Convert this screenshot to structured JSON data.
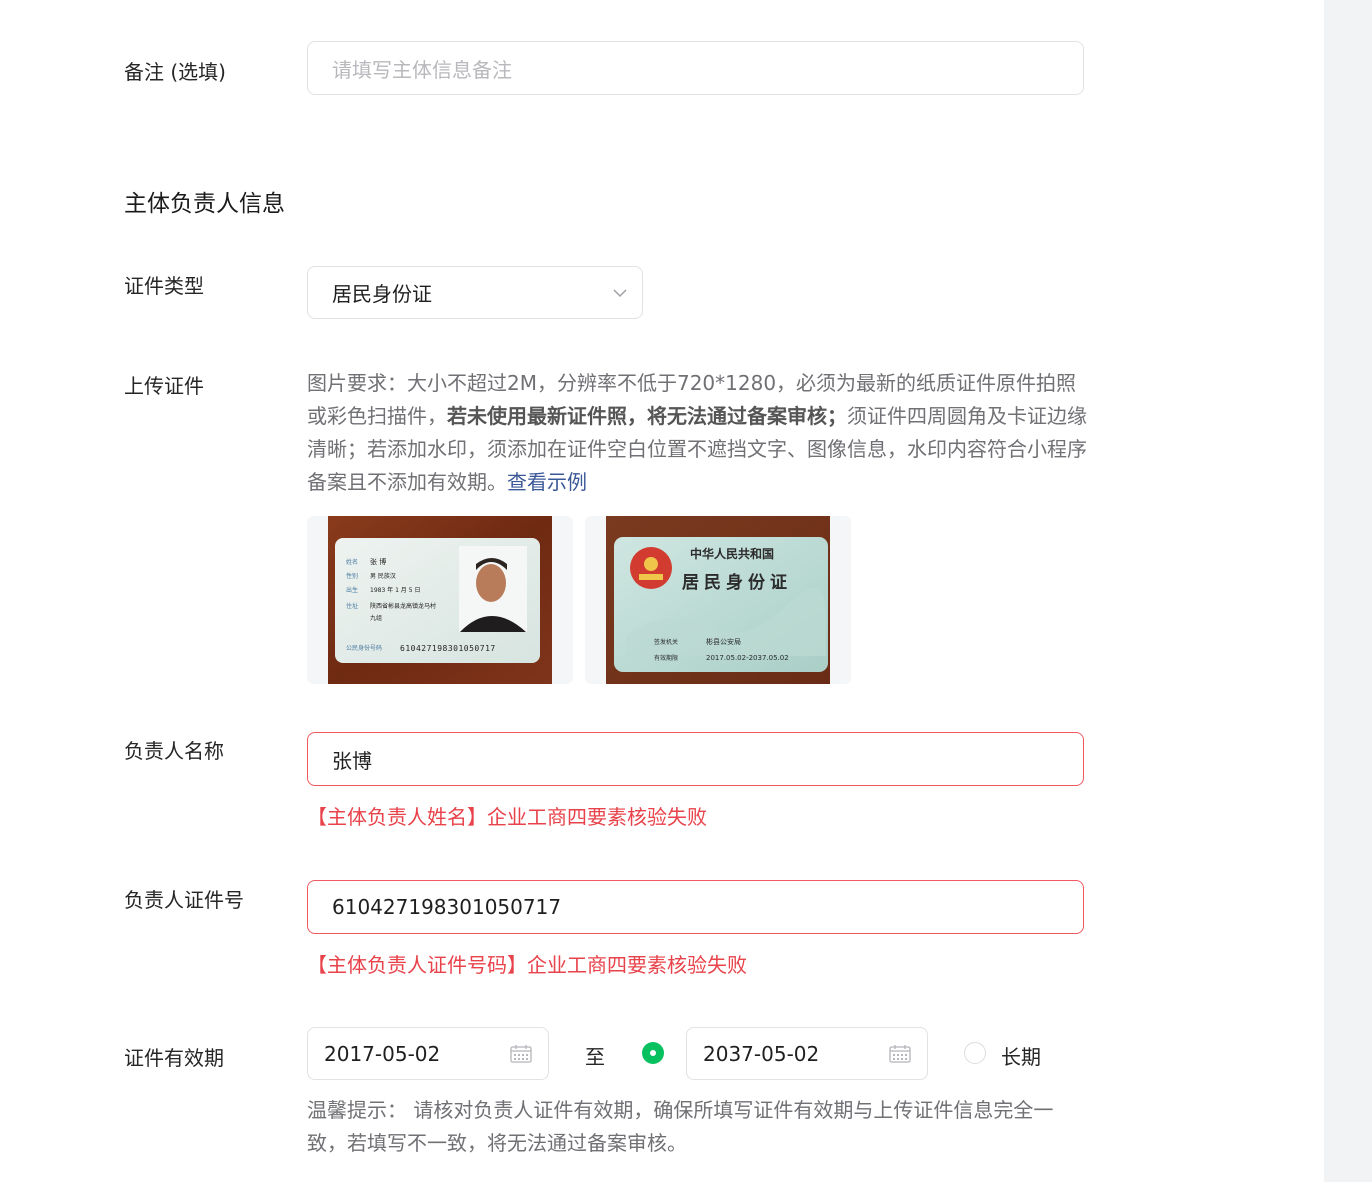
{
  "remark": {
    "label": "备注 (选填)",
    "placeholder": "请填写主体信息备注"
  },
  "section_title": "主体负责人信息",
  "id_type": {
    "label": "证件类型",
    "value": "居民身份证"
  },
  "upload": {
    "label": "上传证件",
    "hint_part1": "图片要求：大小不超过2M，分辨率不低于720*1280，必须为最新的纸质证件原件拍照或彩色扫描件，",
    "hint_bold": "若未使用最新证件照，将无法通过备案审核；",
    "hint_part2": "须证件四周圆角及卡证边缘清晰；若添加水印，须添加在证件空白位置不遮挡文字、图像信息，水印内容符合小程序备案且不添加有效期。",
    "example_link": "查看示例",
    "front_card": {
      "rows": [
        {
          "k": "姓名",
          "v": "张 博"
        },
        {
          "k": "性别",
          "v": "男    民族汉"
        },
        {
          "k": "出生",
          "v": "1983 年 1 月 5 日"
        },
        {
          "k": "住址",
          "v": "陕西省彬县龙高镇龙马村"
        },
        {
          "k": "",
          "v": "九组"
        }
      ],
      "id_label": "公民身份号码",
      "id_number": "610427198301050717"
    },
    "back_card": {
      "country": "中华人民共和国",
      "title": "居民身份证",
      "authority_label": "签发机关",
      "authority": "彬县公安局",
      "validity_label": "有效期限",
      "validity": "2017.05.02-2037.05.02"
    }
  },
  "person_name": {
    "label": "负责人名称",
    "value": "张博",
    "error": "【主体负责人姓名】企业工商四要素核验失败"
  },
  "person_id": {
    "label": "负责人证件号",
    "value": "610427198301050717",
    "error": "【主体负责人证件号码】企业工商四要素核验失败"
  },
  "validity": {
    "label": "证件有效期",
    "start": "2017-05-02",
    "to": "至",
    "end": "2037-05-02",
    "end_selected": true,
    "long_term": "长期",
    "long_term_selected": false,
    "tip": "温馨提示： 请核对负责人证件有效期，确保所填写证件有效期与上传证件信息完全一致，若填写不一致，将无法通过备案审核。"
  },
  "colors": {
    "error": "#e8424a",
    "radio_active": "#07c160",
    "link": "#3b5898"
  }
}
